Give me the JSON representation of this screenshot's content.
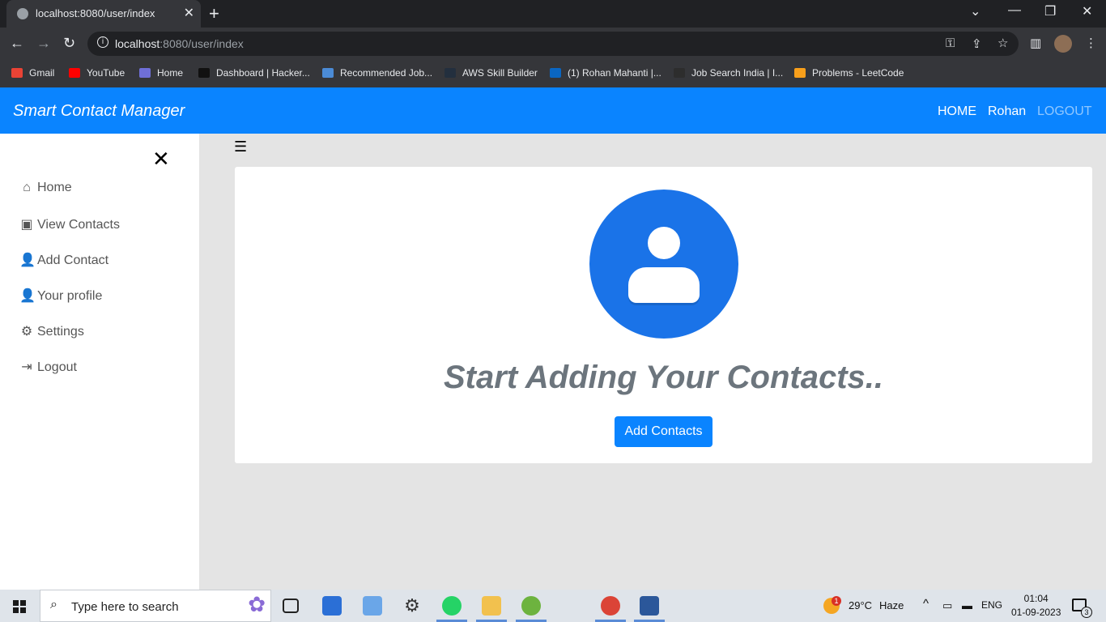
{
  "browser": {
    "tab_title": "localhost:8080/user/index",
    "tab_close": "✕",
    "new_tab": "+",
    "url_host": "localhost",
    "url_rest": ":8080/user/index",
    "bookmarks": [
      {
        "label": "Gmail",
        "color": "#ea4335"
      },
      {
        "label": "YouTube",
        "color": "#ff0000"
      },
      {
        "label": "Home",
        "color": "#6f6fd8"
      },
      {
        "label": "Dashboard | Hacker...",
        "color": "#111111"
      },
      {
        "label": "Recommended Job...",
        "color": "#4b8bd6"
      },
      {
        "label": "AWS Skill Builder",
        "color": "#232f3e"
      },
      {
        "label": "(1) Rohan Mahanti |...",
        "color": "#0a66c2"
      },
      {
        "label": "Job Search India | I...",
        "color": "#2d2d2d"
      },
      {
        "label": "Problems - LeetCode",
        "color": "#f89f1b"
      }
    ]
  },
  "app": {
    "brand": "Smart Contact Manager",
    "nav": {
      "home": "HOME",
      "user": "Rohan",
      "logout": "LOGOUT"
    },
    "sidebar": {
      "close_glyph": "✕",
      "items": [
        {
          "label": "Home",
          "icon": "home-icon",
          "glyph": "⌂"
        },
        {
          "label": "View Contacts",
          "icon": "address-book-icon",
          "glyph": "▣"
        },
        {
          "label": "Add Contact",
          "icon": "user-plus-icon",
          "glyph": "👤"
        },
        {
          "label": "Your profile",
          "icon": "user-icon",
          "glyph": "👤"
        },
        {
          "label": "Settings",
          "icon": "gear-icon",
          "glyph": "⚙"
        },
        {
          "label": "Logout",
          "icon": "sign-out-icon",
          "glyph": "⇥"
        }
      ]
    },
    "main": {
      "hamburger": "☰",
      "headline": "Start Adding Your Contacts..",
      "add_button": "Add Contacts"
    }
  },
  "taskbar": {
    "search_placeholder": "Type here to search",
    "weather_temp": "29°C",
    "weather_text": "Haze",
    "weather_badge": "1",
    "language": "ENG",
    "time": "01:04",
    "date": "01-09-2023",
    "notifications": "3"
  },
  "colors": {
    "navbar": "#0a84ff",
    "avatar": "#1a73e8",
    "headline": "#6c757d"
  }
}
